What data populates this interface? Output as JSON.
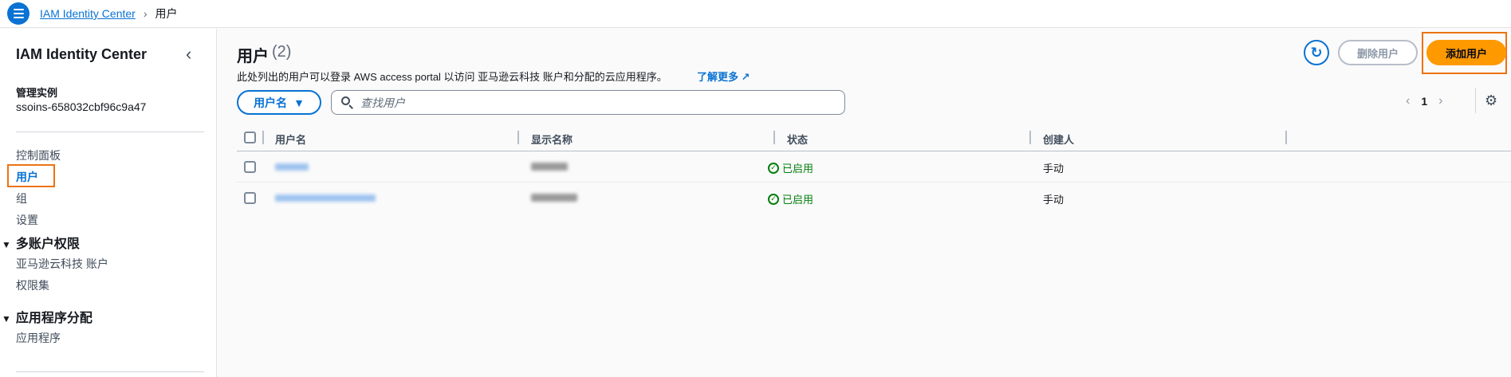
{
  "breadcrumb": {
    "parent": "IAM Identity Center",
    "current": "用户"
  },
  "sidebar": {
    "title": "IAM Identity Center",
    "instance_label": "管理实例",
    "instance_value": "ssoins-658032cbf96c9a47",
    "items": [
      {
        "label": "控制面板"
      },
      {
        "label": "用户",
        "active": true
      },
      {
        "label": "组"
      },
      {
        "label": "设置"
      }
    ],
    "sections": [
      {
        "label": "多账户权限",
        "items": [
          {
            "label": "亚马逊云科技 账户"
          },
          {
            "label": "权限集"
          }
        ]
      },
      {
        "label": "应用程序分配",
        "items": [
          {
            "label": "应用程序"
          }
        ]
      }
    ]
  },
  "main": {
    "title": "用户",
    "count": "(2)",
    "description": "此处列出的用户可以登录 AWS access portal 以访问 亚马逊云科技 账户和分配的云应用程序。",
    "learn_more": "了解更多",
    "delete_label": "删除用户",
    "add_label": "添加用户",
    "filter_label": "用户名",
    "search_placeholder": "查找用户",
    "page": "1",
    "columns": [
      "用户名",
      "显示名称",
      "状态",
      "创建人"
    ],
    "rows": [
      {
        "status": "已启用",
        "created_by": "手动"
      },
      {
        "status": "已启用",
        "created_by": "手动"
      }
    ]
  },
  "colors": {
    "accent": "#0972d3",
    "primary_button": "#ff9900",
    "highlight": "#ec7211",
    "success": "#037f0c"
  },
  "icons": [
    "menu-icon",
    "chevron-right-icon",
    "chevron-left-icon",
    "refresh-icon",
    "external-link-icon",
    "search-icon",
    "caret-down-icon",
    "settings-icon",
    "check-circle-icon"
  ]
}
